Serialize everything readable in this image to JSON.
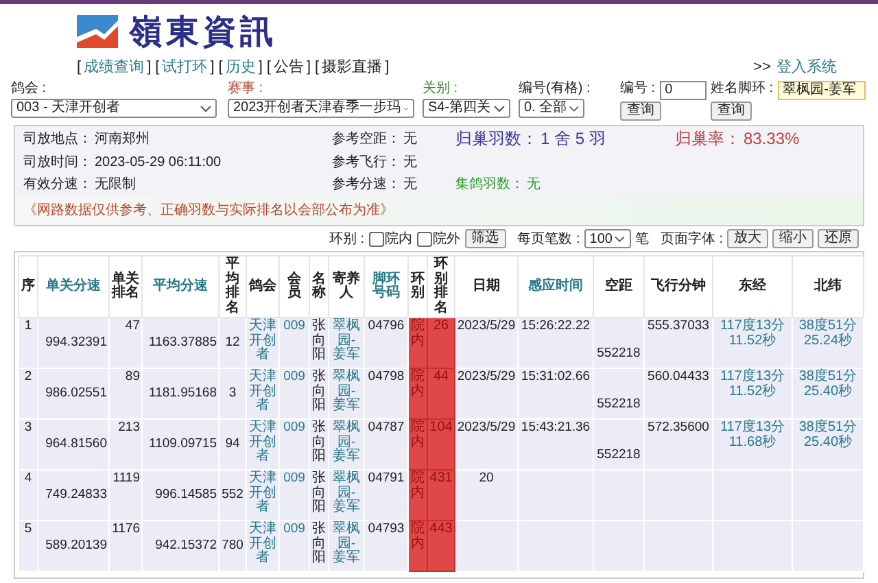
{
  "header": {
    "title": "嶺東資訊"
  },
  "nav": {
    "open": "[",
    "close": "]",
    "items": [
      {
        "label": "成绩查询",
        "link": true
      },
      {
        "label": "试打环",
        "link": true
      },
      {
        "label": "历史",
        "link": true
      },
      {
        "label": "公告",
        "link": false
      },
      {
        "label": "摄影直播",
        "link": false
      }
    ],
    "login_prefix": ">>",
    "login": "登入系统"
  },
  "filters": [
    {
      "label": "鸽会 :",
      "kind": "select",
      "value": "003 - 天津开创者",
      "color": "#222222"
    },
    {
      "label": "赛事 :",
      "kind": "select",
      "value": "2023开创者天津春季一步玛",
      "color": "#b0402a"
    },
    {
      "label": "关别 :",
      "kind": "select",
      "value": "S4-第四关",
      "color": "#3a8a2a"
    },
    {
      "label": "编号(有格) :",
      "kind": "select",
      "value": "0. 全部",
      "color": "#222222"
    },
    {
      "label": "编号 :",
      "kind": "input",
      "value": "0",
      "button": "查询",
      "color": "#222222"
    },
    {
      "label": "姓名脚环 :",
      "kind": "input",
      "value": "翠枫园-姜军",
      "button": "查询",
      "color": "#222222"
    }
  ],
  "info": {
    "left": [
      {
        "label": "司放地点：",
        "value": "河南郑州"
      },
      {
        "label": "司放时间：",
        "value": "2023-05-29 06:11:00"
      },
      {
        "label": "有效分速：",
        "value": "无限制"
      }
    ],
    "middle": [
      {
        "label": "参考空距：",
        "value": "无"
      },
      {
        "label": "参考飞行：",
        "value": "无"
      },
      {
        "label": "参考分速：",
        "value": "无"
      }
    ],
    "summary": [
      {
        "label": "归巢羽数：",
        "value": "1 舍 5 羽",
        "color": "#3a3a9a"
      },
      {
        "label": "归巢率：",
        "value": "83.33%",
        "color": "#c04040"
      },
      {
        "label": "集鸽羽数：",
        "value": "无",
        "color": "#2a9a2a"
      }
    ],
    "notice": "《网路数据仅供参考、正确羽数与实际排名以会部公布为准》"
  },
  "toolbar": {
    "ring_label": "环别 :",
    "checks": [
      {
        "label": "院内",
        "checked": false
      },
      {
        "label": "院外",
        "checked": false
      }
    ],
    "filter_button": "筛选",
    "per_page_label": "每页笔数 :",
    "per_page": "100",
    "per_page_unit": "笔",
    "font_label": "页面字体 :",
    "font_buttons": [
      "放大",
      "缩小",
      "还原"
    ]
  },
  "table": {
    "columns": [
      {
        "label": "序",
        "sortable": false,
        "kind": "text"
      },
      {
        "label": "单关分速",
        "sortable": true,
        "kind": "text"
      },
      {
        "label": "单关排名",
        "sortable": false,
        "kind": "text"
      },
      {
        "label": "平均分速",
        "sortable": true,
        "kind": "text"
      },
      {
        "label": "平均排名",
        "sortable": false,
        "kind": "text"
      },
      {
        "label": "鸽会",
        "sortable": false,
        "kind": "link"
      },
      {
        "label": "会员",
        "sortable": false,
        "kind": "link"
      },
      {
        "label": "名称",
        "sortable": false,
        "kind": "text"
      },
      {
        "label": "寄养人",
        "sortable": false,
        "kind": "link"
      },
      {
        "label": "脚环号码",
        "sortable": true,
        "kind": "text"
      },
      {
        "label": "环别",
        "sortable": false,
        "kind": "flag"
      },
      {
        "label": "环别排名",
        "sortable": false,
        "kind": "flag"
      },
      {
        "label": "日期",
        "sortable": false,
        "kind": "text"
      },
      {
        "label": "感应时间",
        "sortable": true,
        "kind": "text"
      },
      {
        "label": "空距",
        "sortable": false,
        "kind": "text"
      },
      {
        "label": "飞行分钟",
        "sortable": false,
        "kind": "text"
      },
      {
        "label": "东经",
        "sortable": false,
        "kind": "link"
      },
      {
        "label": "北纬",
        "sortable": false,
        "kind": "link"
      }
    ],
    "rows": [
      [
        "1",
        "994.32391",
        "47",
        "1163.37885",
        "12",
        "天津开创者",
        "009",
        "张向阳",
        "翠枫园-姜军",
        "04796",
        "院内",
        "26",
        "2023/5/29",
        "15:26:22.22",
        "552218",
        "555.37033",
        "117度13分 11.52秒",
        "38度51分 25.24秒"
      ],
      [
        "2",
        "986.02551",
        "89",
        "1181.95168",
        "3",
        "天津开创者",
        "009",
        "张向阳",
        "翠枫园-姜军",
        "04798",
        "院内",
        "44",
        "2023/5/29",
        "15:31:02.66",
        "552218",
        "560.04433",
        "117度13分 11.52秒",
        "38度51分 25.40秒"
      ],
      [
        "3",
        "964.81560",
        "213",
        "1109.09715",
        "94",
        "天津开创者",
        "009",
        "张向阳",
        "翠枫园-姜军",
        "04787",
        "院内",
        "104",
        "2023/5/29",
        "15:43:21.36",
        "552218",
        "572.35600",
        "117度13分 11.68秒",
        "38度51分 25.40秒"
      ],
      [
        "4",
        "749.24833",
        "1119",
        "996.14585",
        "552",
        "天津开创者",
        "009",
        "张向阳",
        "翠枫园-姜军",
        "04791",
        "院内",
        "431",
        "20"
      ],
      [
        "5",
        "589.20139",
        "1176",
        "942.15372",
        "780",
        "天津开创者",
        "009",
        "张向阳",
        "翠枫园-姜军",
        "04793",
        "院内",
        "443"
      ]
    ]
  }
}
